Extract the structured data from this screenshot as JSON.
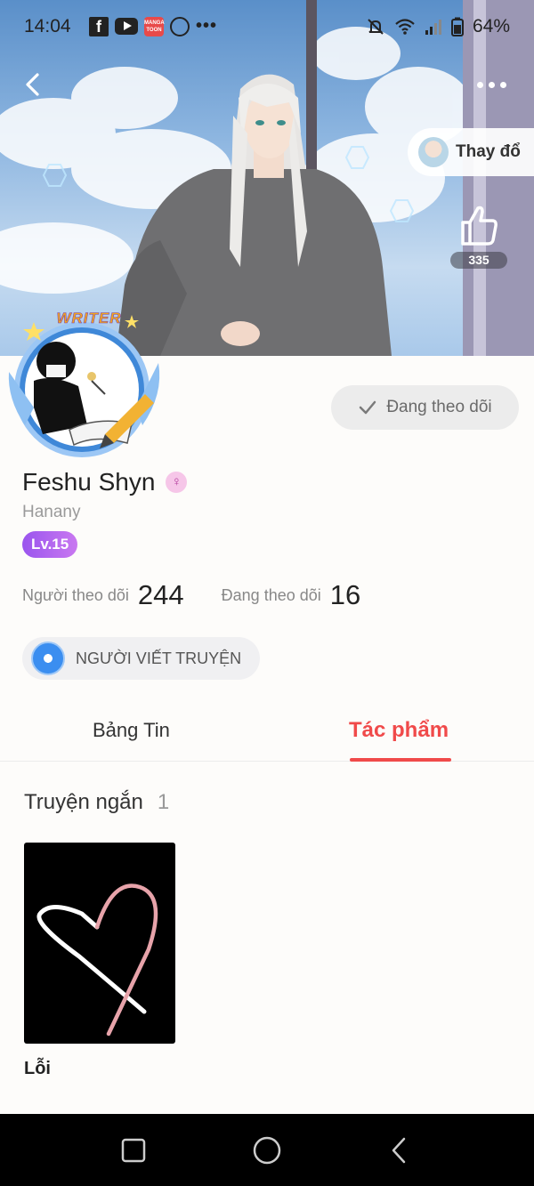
{
  "status_bar": {
    "time": "14:04",
    "battery": "64%",
    "left_icons": [
      "facebook-icon",
      "youtube-icon",
      "mangatoon-icon",
      "messenger-icon",
      "more-dots-icon"
    ],
    "right_icons": [
      "mute-bell-icon",
      "wifi-icon",
      "signal-icon",
      "battery-icon"
    ]
  },
  "header": {
    "change_background_label": "Thay đổ",
    "like_count": "335"
  },
  "profile": {
    "writer_badge": "WRITER",
    "follow_state_label": "Đang theo dõi",
    "name": "Feshu Shyn",
    "username": "Hanany",
    "level": "Lv.15",
    "followers_label": "Người theo dõi",
    "followers_count": "244",
    "following_label": "Đang theo dõi",
    "following_count": "16",
    "role": "NGƯỜI VIẾT TRUYỆN"
  },
  "tabs": [
    {
      "label": "Bảng Tin",
      "active": false
    },
    {
      "label": "Tác phẩm",
      "active": true
    }
  ],
  "works": {
    "section_title": "Truyện ngắn",
    "section_count": "1",
    "items": [
      {
        "title": "Lỗi"
      }
    ]
  },
  "colors": {
    "accent": "#f04a4a",
    "level_gradient_start": "#9a55ee",
    "level_gradient_end": "#c978f0",
    "navbar": "#000000"
  }
}
